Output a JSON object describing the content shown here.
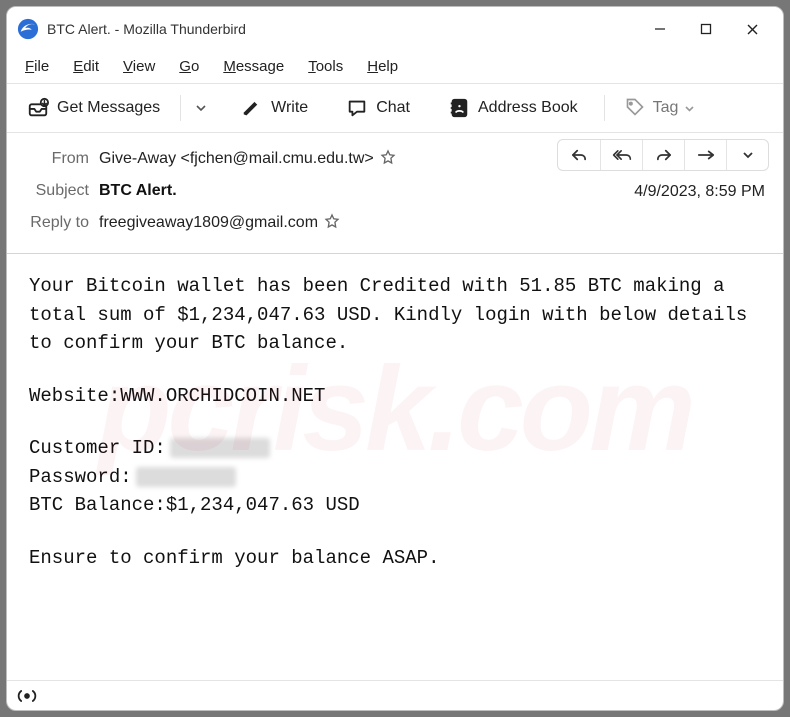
{
  "window": {
    "title": "BTC Alert. - Mozilla Thunderbird"
  },
  "menu": {
    "file": "File",
    "edit": "Edit",
    "view": "View",
    "go": "Go",
    "message": "Message",
    "tools": "Tools",
    "help": "Help"
  },
  "toolbar": {
    "get_messages": "Get Messages",
    "write": "Write",
    "chat": "Chat",
    "address_book": "Address Book",
    "tag": "Tag"
  },
  "headers": {
    "from_label": "From",
    "from_value": "Give-Away <fjchen@mail.cmu.edu.tw>",
    "subject_label": "Subject",
    "subject_value": "BTC Alert.",
    "replyto_label": "Reply to",
    "replyto_value": "freegiveaway1809@gmail.com",
    "datetime": "4/9/2023, 8:59 PM"
  },
  "body": {
    "p1": "Your Bitcoin wallet has been Credited with 51.85 BTC making a total sum of $1,234,047.63 USD. Kindly login with below details to confirm your BTC balance.",
    "p2": "Website:WWW.ORCHIDCOIN.NET",
    "cust_label": "Customer ID:",
    "pass_label": "Password:",
    "balance": "BTC Balance:$1,234,047.63 USD",
    "p3": "Ensure to confirm your balance ASAP."
  },
  "watermark": "pcrisk.com"
}
